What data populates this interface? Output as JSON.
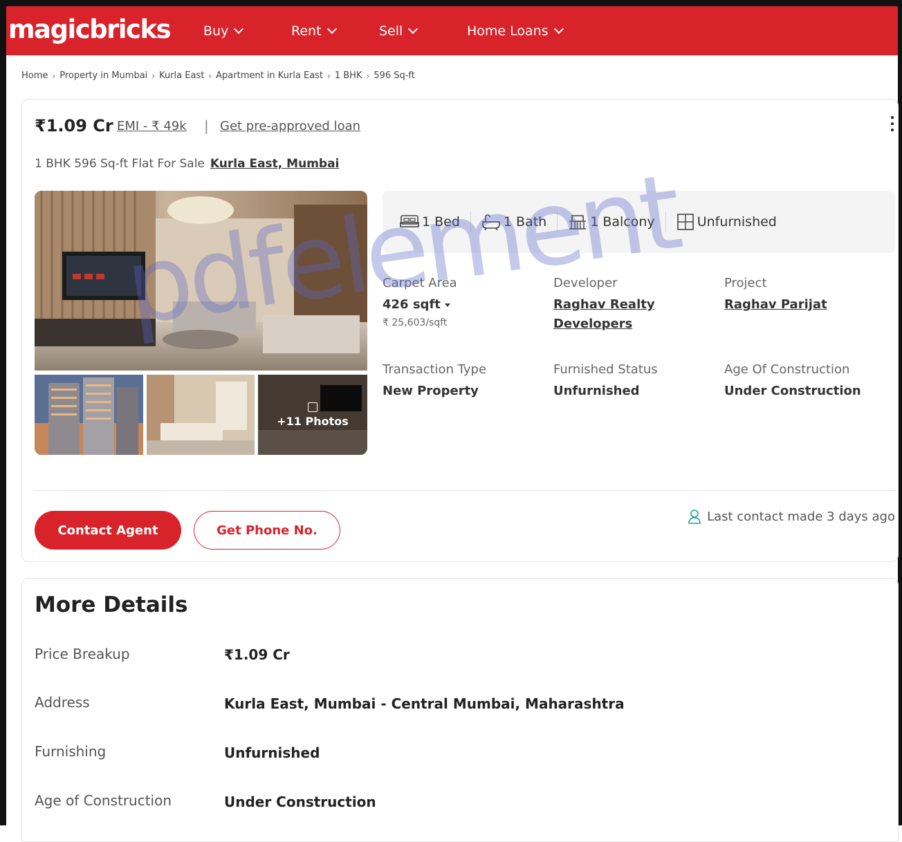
{
  "header": {
    "logo": "magicbricks",
    "nav": [
      "Buy",
      "Rent",
      "Sell",
      "Home Loans"
    ]
  },
  "breadcrumb": [
    "Home",
    "Property in Mumbai",
    "Kurla East",
    "Apartment in Kurla East",
    "1 BHK",
    "596 Sq-ft"
  ],
  "listing": {
    "price": "₹1.09 Cr",
    "emi": "EMI - ₹ 49k",
    "separator": "|",
    "loan": "Get pre-approved loan",
    "subtitle": "1 BHK 596 Sq-ft Flat For Sale",
    "location": "Kurla East, Mumbai",
    "photos_count": "+11 Photos",
    "amenities": {
      "bed": "1 Bed",
      "bath": "1 Bath",
      "balcony": "1 Balcony",
      "furnishing": "Unfurnished"
    },
    "summary": {
      "carpet_label": "Carpet Area",
      "carpet_value": "426 sqft",
      "carpet_rate": "₹ 25,603/sqft",
      "developer_label": "Developer",
      "developer_value_1": "Raghav Realty",
      "developer_value_2": "Developers",
      "project_label": "Project",
      "project_value": "Raghav Parijat",
      "transaction_label": "Transaction Type",
      "transaction_value": "New Property",
      "furnished_label": "Furnished Status",
      "furnished_value": "Unfurnished",
      "age_label": "Age Of Construction",
      "age_value": "Under Construction"
    },
    "contact_button": "Contact Agent",
    "phone_button": "Get Phone No.",
    "last_contact": "Last contact made 3 days ago"
  },
  "more_details": {
    "title": "More Details",
    "rows": [
      {
        "label": "Price Breakup",
        "value": "₹1.09 Cr"
      },
      {
        "label": "Address",
        "value": "Kurla East, Mumbai - Central Mumbai, Maharashtra"
      },
      {
        "label": "Furnishing",
        "value": "Unfurnished"
      },
      {
        "label": "Age of Construction",
        "value": "Under Construction"
      }
    ]
  },
  "watermark": "pdfelement",
  "colors": {
    "brand": "#d8232a",
    "contact_icon": "#1aa58c"
  }
}
